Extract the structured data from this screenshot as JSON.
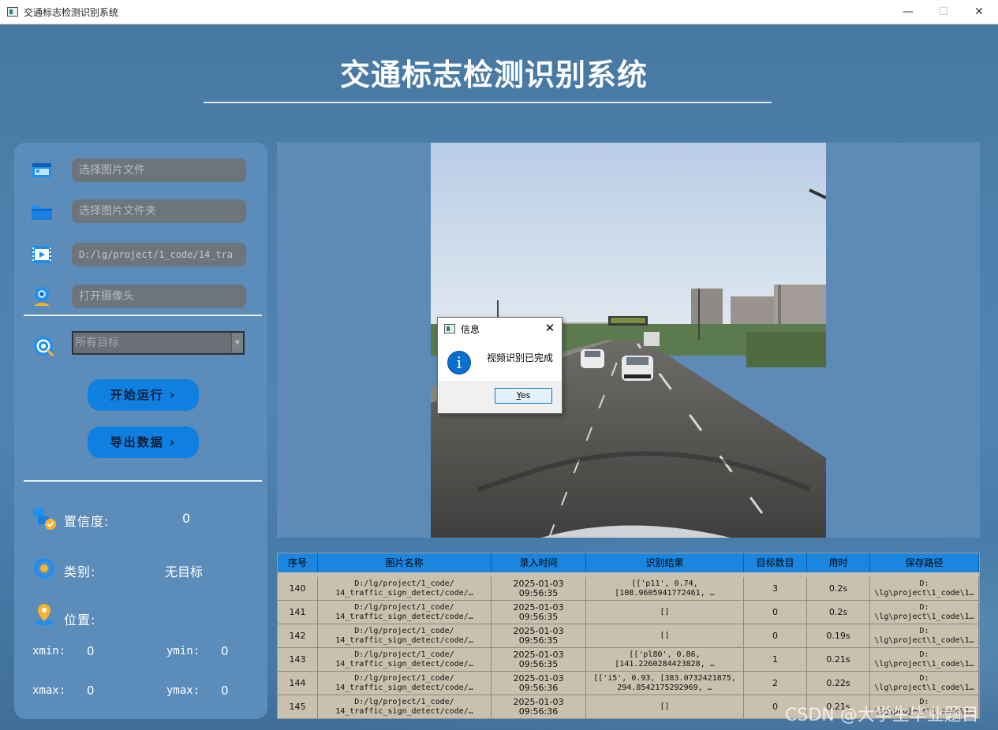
{
  "window": {
    "title": "交通标志检测识别系统",
    "minimize_glyph": "—",
    "maximize_glyph": "☐",
    "close_glyph": "✕"
  },
  "header": {
    "title": "交通标志检测识别系统"
  },
  "left_panel": {
    "inputs": [
      {
        "icon": "image-file-icon",
        "placeholder": "选择图片文件",
        "value": ""
      },
      {
        "icon": "folder-icon",
        "placeholder": "选择图片文件夹",
        "value": ""
      },
      {
        "icon": "video-icon",
        "placeholder": "",
        "value": "D:/lg/project/1_code/14_tra"
      },
      {
        "icon": "webcam-icon",
        "placeholder": "打开摄像头",
        "value": ""
      }
    ],
    "target_select": {
      "selected": "所有目标"
    },
    "buttons": {
      "start": "开始运行 ›",
      "export": "导出数据 ›"
    },
    "stats": {
      "confidence_label": "置信度:",
      "confidence_value": "0",
      "class_label": "类别:",
      "class_value": "无目标",
      "position_label": "位置:",
      "xmin_label": "xmin:",
      "xmin_value": "0",
      "ymin_label": "ymin:",
      "ymin_value": "0",
      "xmax_label": "xmax:",
      "xmax_value": "0",
      "ymax_label": "ymax:",
      "ymax_value": "0"
    }
  },
  "dialog": {
    "title": "信息",
    "message": "视频识别已完成",
    "ok_label_prefix": "",
    "ok_label_hotkey": "Y",
    "ok_label_rest": "es"
  },
  "table": {
    "headers": [
      "序号",
      "图片名称",
      "录入时间",
      "识别结果",
      "目标数目",
      "用时",
      "保存路径"
    ],
    "rows": [
      {
        "id": "140",
        "name": "D:/lg/project/1_code/\n14_traffic_sign_detect/code/…",
        "time": "2025-01-03\n09:56:35",
        "result": "[['p11', 0.74,\n[108.9605941772461, …",
        "count": "3",
        "elapsed": "0.2s",
        "path": "D:\n\\lg\\project\\1_code\\1…"
      },
      {
        "id": "141",
        "name": "D:/lg/project/1_code/\n14_traffic_sign_detect/code/…",
        "time": "2025-01-03\n09:56:35",
        "result": "[]",
        "count": "0",
        "elapsed": "0.2s",
        "path": "D:\n\\lg\\project\\1_code\\1…"
      },
      {
        "id": "142",
        "name": "D:/lg/project/1_code/\n14_traffic_sign_detect/code/…",
        "time": "2025-01-03\n09:56:35",
        "result": "[]",
        "count": "0",
        "elapsed": "0.19s",
        "path": "D:\n\\lg\\project\\1_code\\1…"
      },
      {
        "id": "143",
        "name": "D:/lg/project/1_code/\n14_traffic_sign_detect/code/…",
        "time": "2025-01-03\n09:56:35",
        "result": "[['pl80', 0.86,\n[141.2260284423828, …",
        "count": "1",
        "elapsed": "0.21s",
        "path": "D:\n\\lg\\project\\1_code\\1…"
      },
      {
        "id": "144",
        "name": "D:/lg/project/1_code/\n14_traffic_sign_detect/code/…",
        "time": "2025-01-03\n09:56:36",
        "result": "[['i5', 0.93, [383.0732421875,\n294.8542175292969, …",
        "count": "2",
        "elapsed": "0.22s",
        "path": "D:\n\\lg\\project\\1_code\\1…"
      },
      {
        "id": "145",
        "name": "D:/lg/project/1_code/\n14_traffic_sign_detect/code/…",
        "time": "2025-01-03\n09:56:36",
        "result": "[]",
        "count": "0",
        "elapsed": "0.21s",
        "path": "D:\n\\lg\\project\\1_code\\1…"
      }
    ]
  },
  "watermark": "CSDN @大学生毕业题目",
  "colors": {
    "accent_button": "#0f7fe0",
    "table_header": "#1a86e0",
    "panel": "#5c8cba",
    "background": "#4d7fab"
  }
}
